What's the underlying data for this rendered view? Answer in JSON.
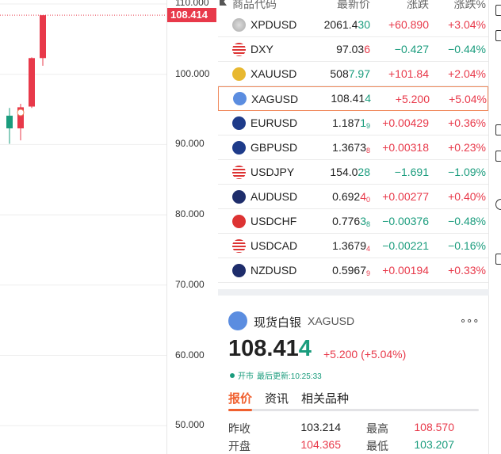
{
  "chart": {
    "y_ticks": [
      "110.000",
      "100.000",
      "90.000",
      "80.000",
      "70.000",
      "60.000",
      "50.000"
    ],
    "current_price": "108.414",
    "candles": [
      {
        "o": 94.1,
        "c": 92.3,
        "h": 95.2,
        "l": 90.1
      },
      {
        "o": 92.3,
        "c": 95.3,
        "h": 95.8,
        "l": 90.6
      },
      {
        "o": 95.4,
        "c": 102.3,
        "h": 102.4,
        "l": 95.2
      },
      {
        "o": 102.3,
        "c": 108.4,
        "h": 108.4,
        "l": 101.2
      }
    ],
    "colors": {
      "up": "#e8394a",
      "down": "#1a9c7d"
    }
  },
  "list": {
    "headers": [
      "商品代码",
      "最新价",
      "涨跌",
      "涨跌%"
    ],
    "rows": [
      {
        "icon": "palladium-icon",
        "symbol": "XPDUSD",
        "price_main": "2061.4",
        "price_hl": "30",
        "price_sub": "",
        "dir": "up",
        "hl": "dn",
        "change": "+60.890",
        "pct": "+3.04%"
      },
      {
        "icon": "us-flag-icon",
        "symbol": "DXY",
        "price_main": "97.03",
        "price_hl": "6",
        "price_sub": "",
        "dir": "dn",
        "hl": "up",
        "change": "−0.427",
        "pct": "−0.44%"
      },
      {
        "icon": "gold-icon",
        "symbol": "XAUUSD",
        "price_main": "508",
        "price_hl": "7.97",
        "price_sub": "",
        "dir": "up",
        "hl": "dn",
        "change": "+101.84",
        "pct": "+2.04%"
      },
      {
        "icon": "silver-icon",
        "symbol": "XAGUSD",
        "price_main": "108.41",
        "price_hl": "4",
        "price_sub": "",
        "dir": "up",
        "hl": "dn",
        "change": "+5.200",
        "pct": "+5.04%"
      },
      {
        "icon": "eur-usd-flag-icon",
        "symbol": "EURUSD",
        "price_main": "1.187",
        "price_hl": "1",
        "price_sub": "9",
        "dir": "up",
        "hl": "dn",
        "change": "+0.00429",
        "pct": "+0.36%"
      },
      {
        "icon": "gbp-usd-flag-icon",
        "symbol": "GBPUSD",
        "price_main": "1.3673",
        "price_hl": "",
        "price_sub": "8",
        "dir": "up",
        "hl": "up",
        "change": "+0.00318",
        "pct": "+0.23%"
      },
      {
        "icon": "usd-jpy-flag-icon",
        "symbol": "USDJPY",
        "price_main": "154.0",
        "price_hl": "28",
        "price_sub": "",
        "dir": "dn",
        "hl": "dn",
        "change": "−1.691",
        "pct": "−1.09%"
      },
      {
        "icon": "aud-usd-flag-icon",
        "symbol": "AUDUSD",
        "price_main": "0.692",
        "price_hl": "4",
        "price_sub": "0",
        "dir": "up",
        "hl": "up",
        "change": "+0.00277",
        "pct": "+0.40%"
      },
      {
        "icon": "usd-chf-flag-icon",
        "symbol": "USDCHF",
        "price_main": "0.776",
        "price_hl": "3",
        "price_sub": "8",
        "dir": "dn",
        "hl": "dn",
        "change": "−0.00376",
        "pct": "−0.48%"
      },
      {
        "icon": "usd-cad-flag-icon",
        "symbol": "USDCAD",
        "price_main": "1.3679",
        "price_hl": "",
        "price_sub": "4",
        "dir": "dn",
        "hl": "up",
        "change": "−0.00221",
        "pct": "−0.16%"
      },
      {
        "icon": "nzd-usd-flag-icon",
        "symbol": "NZDUSD",
        "price_main": "0.5967",
        "price_hl": "",
        "price_sub": "9",
        "dir": "up",
        "hl": "up",
        "change": "+0.00194",
        "pct": "+0.33%"
      }
    ]
  },
  "detail": {
    "name": "现货白银",
    "symbol": "XAGUSD",
    "more": "∘∘∘",
    "price_main": "108.41",
    "price_hl": "4",
    "change": "+5.200 (+5.04%)",
    "status": "开市",
    "updated": "最后更新:10:25:33",
    "tabs": [
      "报价",
      "资讯",
      "相关品种"
    ],
    "stats": [
      {
        "label": "昨收",
        "value": "103.214",
        "cls": ""
      },
      {
        "label": "最高",
        "value": "108.570",
        "cls": "up"
      },
      {
        "label": "开盘",
        "value": "104.365",
        "cls": "up"
      },
      {
        "label": "最低",
        "value": "103.207",
        "cls": "dn"
      }
    ]
  }
}
